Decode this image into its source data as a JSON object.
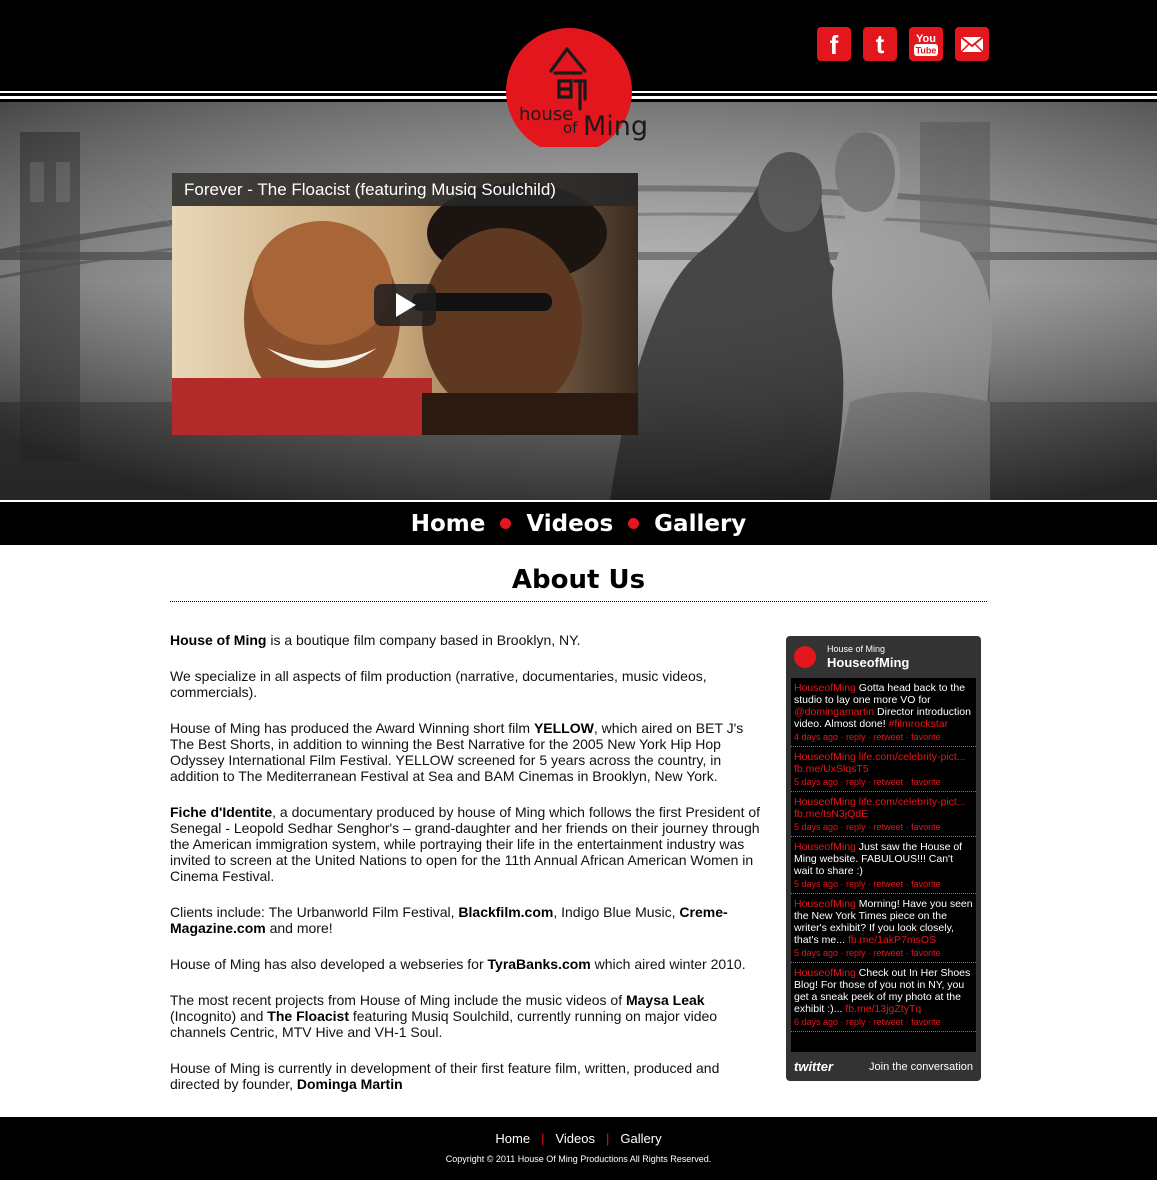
{
  "social": {
    "facebook_label": "f",
    "twitter_label": "t",
    "youtube_label_top": "You",
    "youtube_label_bottom": "Tube"
  },
  "logo": {
    "line1": "house",
    "line2": "of",
    "line3": "Ming"
  },
  "video": {
    "title": "Forever - The Floacist (featuring Musiq Soulchild)"
  },
  "nav": {
    "items": [
      "Home",
      "Videos",
      "Gallery"
    ]
  },
  "main": {
    "title": "About Us",
    "paragraphs": [
      {
        "b1": "House of Ming",
        "t1": " is a boutique film company based in Brooklyn, NY."
      },
      {
        "t1": "We specialize in all aspects of film production (narrative, documentaries, music videos, commercials)."
      },
      {
        "t1": "House of Ming has produced the Award Winning short film ",
        "b1": "YELLOW",
        "t2": ", which aired on BET J's The Best Shorts, in addition to winning the Best Narrative for the 2005 New York Hip Hop Odyssey International Film Festival. YELLOW screened for 5 years across the country, in addition to The Mediterranean Festival at Sea and BAM Cinemas in Brooklyn, New York."
      },
      {
        "b1": "Fiche d'Identite",
        "t1": ", a documentary produced by house of Ming which follows the first President of Senegal - Leopold Sedhar Senghor's – grand-daughter and her friends on their journey through the American immigration system, while portraying their life in the entertainment industry was invited to screen at the United Nations to open for the 11th Annual African American Women in Cinema Festival."
      },
      {
        "t1": "Clients include: The Urbanworld Film Festival, ",
        "b1": "Blackfilm.com",
        "t2": ", Indigo Blue Music, ",
        "b2": "Creme-Magazine.com",
        "t3": " and more!"
      },
      {
        "t1": "House of Ming has also developed a webseries for ",
        "b1": "TyraBanks.com",
        "t2": " which aired winter 2010."
      },
      {
        "t1": "The most recent projects from House of Ming include the music videos of ",
        "b1": "Maysa Leak",
        "t2": " (Incognito) and ",
        "b2": "The Floacist",
        "t3": " featuring Musiq Soulchild, currently running on major video channels Centric, MTV Hive and VH-1 Soul."
      },
      {
        "t1": "House of Ming is currently in development of their first feature film, written, produced and directed by founder, ",
        "b1": "Dominga Martin"
      }
    ]
  },
  "twitter": {
    "subtitle": "House of Ming",
    "handle": "HouseofMing",
    "tweets": [
      {
        "user": "HouseofMing",
        "text": " Gotta head back to the studio to lay one more VO for ",
        "link": "@domingamartin",
        "text2": " Director introduction video. Almost done! ",
        "link2": "#filmrockstar",
        "time": "4 days ago"
      },
      {
        "user": "HouseofMing",
        "text": " ",
        "link": "life.com/celebrity-pict... fb.me/UxSlqsT5",
        "text2": "",
        "link2": "",
        "time": "5 days ago"
      },
      {
        "user": "HouseofMing",
        "text": " ",
        "link": "life.com/celebrity-pict... fb.me/tsN3jQdE",
        "text2": "",
        "link2": "",
        "time": "5 days ago"
      },
      {
        "user": "HouseofMing",
        "text": " Just saw the House of Ming website. FABULOUS!!! Can't wait to share :)",
        "link": "",
        "text2": "",
        "link2": "",
        "time": "5 days ago"
      },
      {
        "user": "HouseofMing",
        "text": " Morning! Have you seen the New York Times piece on the writer's exhibit? If you look closely, that's me... ",
        "link": "fb.me/1akP7msOS",
        "text2": "",
        "link2": "",
        "time": "5 days ago"
      },
      {
        "user": "HouseofMing",
        "text": " Check out In Her Shoes Blog! For those of you not in NY, you get a sneak peek of my photo at the exhibit :)... ",
        "link": "fb.me/13jgZtyTq",
        "text2": "",
        "link2": "",
        "time": "6 days ago"
      }
    ],
    "reply": "reply",
    "retweet": "retweet",
    "favorite": "favorite",
    "logo": "twitter",
    "join": "Join the conversation"
  },
  "footer": {
    "links": [
      "Home",
      "Videos",
      "Gallery"
    ],
    "copyright": "Copyright © 2011 House Of Ming Productions All Rights Reserved."
  },
  "colors": {
    "accent": "#e3161d",
    "dark": "#000000"
  }
}
